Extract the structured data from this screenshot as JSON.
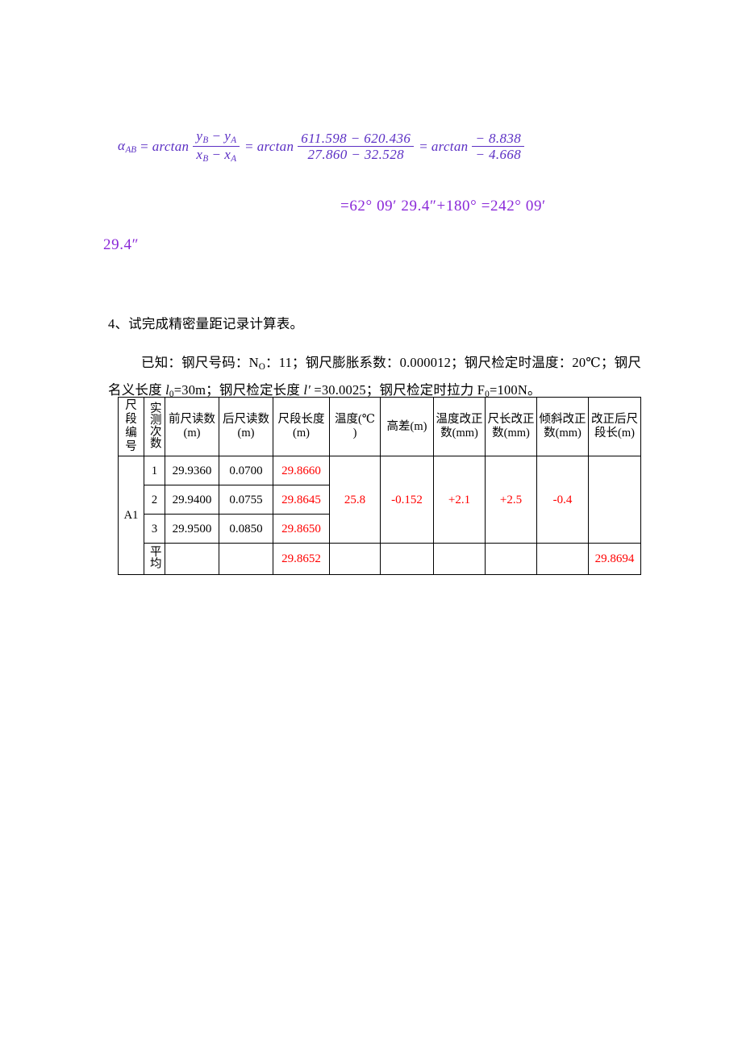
{
  "formula": {
    "lhs_var": "α",
    "lhs_sub": "AB",
    "eq1": "=",
    "fn1": "arctan",
    "frac1_num_a": "y",
    "frac1_num_a_sub": "B",
    "frac1_minus": " − ",
    "frac1_num_b": "y",
    "frac1_num_b_sub": "A",
    "frac1_den_a": "x",
    "frac1_den_a_sub": "B",
    "frac1_den_b": "x",
    "frac1_den_b_sub": "A",
    "eq2": "=",
    "fn2": "arctan",
    "frac2_num": "611.598 − 620.436",
    "frac2_den": "27.860 − 32.528",
    "eq3": "=",
    "fn3": "arctan",
    "frac3_num": "− 8.838",
    "frac3_den": "− 4.668",
    "color": "#5B2FC4"
  },
  "angle_result": {
    "line1": "=62° 09′ 29.4″+180° =242° 09′",
    "line2": "29.4″",
    "color": "#8A28D8"
  },
  "question": {
    "number_text": "4、试完成精密量距记录计算表。",
    "given_line1": "已知：钢尺号码：N",
    "given_line1_sub": "O",
    "given_line1_cont": "：11；钢尺膨胀系数：0.000012；钢尺检定时温度：20℃；钢尺",
    "given_line2_a": "名义长度 ",
    "given_line2_l0": "l",
    "given_line2_l0_sub": "0",
    "given_line2_b": "=30m；钢尺检定长度 ",
    "given_line2_lp": "l′",
    "given_line2_c": " =30.0025；钢尺检定时拉力 F",
    "given_line2_f_sub": "0",
    "given_line2_d": "=100N。"
  },
  "table": {
    "headers": {
      "segment_no": "尺段编号",
      "measure_count": "实测次数",
      "front_reading": "前尺读数",
      "front_reading_unit": "(m)",
      "back_reading": "后尺读数",
      "back_reading_unit": "(m)",
      "segment_length": "尺段长度",
      "segment_length_unit": "(m)",
      "temperature": "温度(℃ )",
      "height_diff": "高差(m)",
      "temp_correction": "温度改正",
      "temp_correction_unit": "数(mm)",
      "length_correction": "尺长改正",
      "length_correction_unit": "数(mm)",
      "slope_correction": "倾斜改正",
      "slope_correction_unit": "数(mm)",
      "corrected_length": "改正后尺",
      "corrected_length_unit": "段长(m)"
    },
    "segment_label": "A1",
    "average_label": "平均",
    "rows": [
      {
        "index": "1",
        "front_reading": "29.9360",
        "back_reading": "0.0700",
        "segment_length": "29.8660"
      },
      {
        "index": "2",
        "front_reading": "29.9400",
        "back_reading": "0.0755",
        "segment_length": "29.8645"
      },
      {
        "index": "3",
        "front_reading": "29.9500",
        "back_reading": "0.0850",
        "segment_length": "29.8650"
      }
    ],
    "merged": {
      "temperature": "25.8",
      "height_diff": "-0.152",
      "temp_correction": "+2.1",
      "length_correction": "+2.5",
      "slope_correction": "-0.4"
    },
    "average_row": {
      "segment_length": "29.8652",
      "corrected_length": "29.8694"
    },
    "answer_color": "#FF0000"
  }
}
